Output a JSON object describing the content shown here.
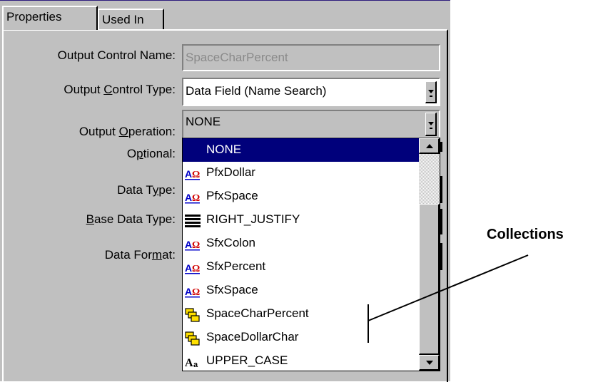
{
  "tabs": [
    {
      "label": "Properties",
      "active": true
    },
    {
      "label": "Used In",
      "active": false
    }
  ],
  "form": {
    "output_control_name": {
      "label": "Output Control Name:",
      "value": "SpaceCharPercent"
    },
    "output_control_type": {
      "label_pre": "Output ",
      "label_key": "C",
      "label_post": "ontrol Type:",
      "value": "Data Field (Name Search)"
    },
    "output_operation": {
      "label_pre": "Output ",
      "label_key": "O",
      "label_post": "peration:",
      "value": "NONE"
    },
    "optional": {
      "label_pre": "O",
      "label_key": "p",
      "label_post": "tional:"
    },
    "data_type": {
      "label_pre": "Data T",
      "label_key": "y",
      "label_post": "pe:"
    },
    "base_data_type": {
      "label_pre": "",
      "label_key": "B",
      "label_post": "ase Data Type:"
    },
    "data_format": {
      "label_pre": "Data For",
      "label_key": "m",
      "label_post": "at:"
    }
  },
  "dropdown": {
    "items": [
      {
        "label": "NONE",
        "icon": "none",
        "selected": true
      },
      {
        "label": "PfxDollar",
        "icon": "text-style-icon"
      },
      {
        "label": "PfxSpace",
        "icon": "text-style-icon"
      },
      {
        "label": "RIGHT_JUSTIFY",
        "icon": "justify-lines-icon"
      },
      {
        "label": "SfxColon",
        "icon": "text-style-icon"
      },
      {
        "label": "SfxPercent",
        "icon": "text-style-icon"
      },
      {
        "label": "SfxSpace",
        "icon": "text-style-icon"
      },
      {
        "label": "SpaceCharPercent",
        "icon": "collection-icon"
      },
      {
        "label": "SpaceDollarChar",
        "icon": "collection-icon"
      },
      {
        "label": "UPPER_CASE",
        "icon": "uppercase-icon"
      }
    ]
  },
  "annotation": {
    "label": "Collections"
  },
  "colors": {
    "selection": "#00007b",
    "face": "#c0c0c0",
    "disabled_text": "#8a8a8a",
    "icon_blue": "#0000c8",
    "icon_red": "#d00000",
    "icon_yellow": "#ffe000"
  }
}
